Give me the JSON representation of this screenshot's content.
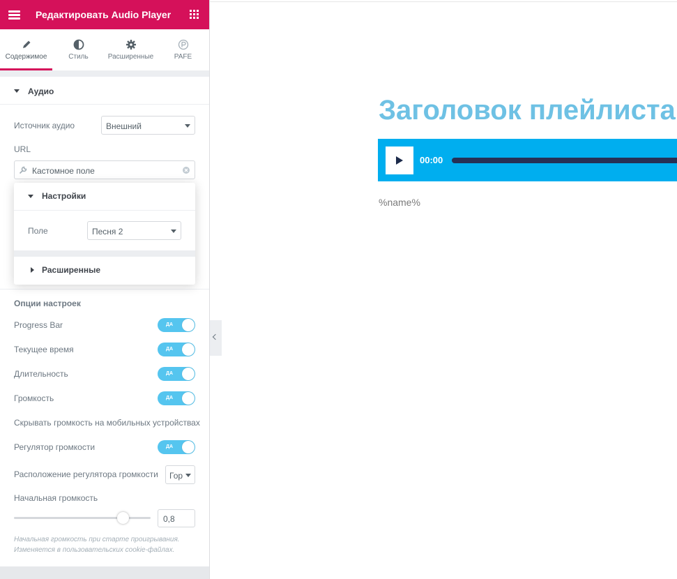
{
  "panel": {
    "title": "Редактировать Audio Player",
    "header_color": "#d5115a",
    "tabs": [
      {
        "label": "Содержимое",
        "icon": "pencil-icon",
        "active": true
      },
      {
        "label": "Стиль",
        "icon": "contrast-icon",
        "active": false
      },
      {
        "label": "Расширенные",
        "icon": "gear-icon",
        "active": false
      },
      {
        "label": "PAFE",
        "icon": "pafe-icon",
        "active": false
      }
    ],
    "audio_section": {
      "title": "Аудио",
      "source_label": "Источник аудио",
      "source_value": "Внешний",
      "url_label": "URL",
      "url_value": "Кастомное поле"
    },
    "popover": {
      "settings_title": "Настройки",
      "field_label": "Поле",
      "field_value": "Песня 2",
      "advanced_title": "Расширенные"
    },
    "options": {
      "heading": "Опции настроек",
      "toggle_text": "ДА",
      "progress_bar": "Progress Bar",
      "current_time": "Текущее время",
      "duration": "Длительность",
      "volume": "Громкость",
      "hide_volume_mobile": "Скрывать громкость на мобильных устройствах",
      "volume_control": "Регулятор громкости",
      "volume_layout_label": "Расположение регулятора громкости",
      "volume_layout_value": "Гор",
      "start_volume_label": "Начальная громкость",
      "start_volume_value": "0,8",
      "start_volume_fraction": 0.8,
      "hint_line1": "Начальная громкость при старте проигрывания.",
      "hint_line2": "Изменяется в пользовательских cookie-файлах."
    }
  },
  "preview": {
    "playlist_title": "Заголовок плейлиста",
    "time": "00:00",
    "song_name": "%name%",
    "title_color": "#6ec1e4",
    "player_color": "#00aeef"
  }
}
